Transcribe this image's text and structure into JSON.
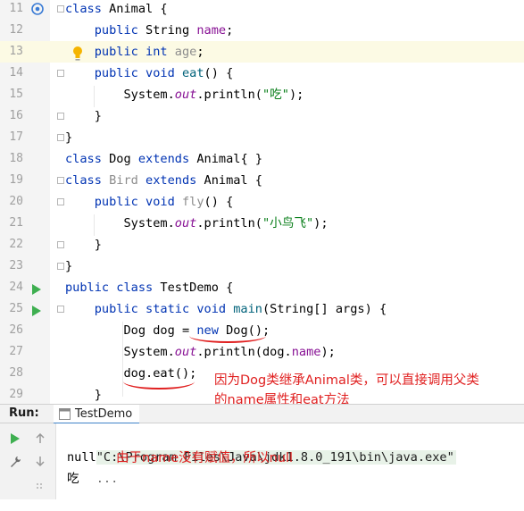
{
  "editor": {
    "lines": [
      {
        "num": "11",
        "tokens": [
          {
            "t": "class ",
            "c": "kw"
          },
          {
            "t": "Animal {",
            "c": ""
          }
        ]
      },
      {
        "num": "12",
        "tokens": [
          {
            "t": "    public ",
            "c": "kw"
          },
          {
            "t": "String ",
            "c": ""
          },
          {
            "t": "name",
            "c": "fd"
          },
          {
            "t": ";",
            "c": ""
          }
        ]
      },
      {
        "num": "13",
        "tokens": [
          {
            "t": "    public ",
            "c": "kw"
          },
          {
            "t": "int ",
            "c": "kw"
          },
          {
            "t": "age",
            "c": "gray"
          },
          {
            "t": ";",
            "c": ""
          }
        ]
      },
      {
        "num": "14",
        "tokens": [
          {
            "t": "    public ",
            "c": "kw"
          },
          {
            "t": "void ",
            "c": "kw"
          },
          {
            "t": "eat",
            "c": "fn"
          },
          {
            "t": "() {",
            "c": ""
          }
        ]
      },
      {
        "num": "15",
        "tokens": [
          {
            "t": "        System.",
            "c": ""
          },
          {
            "t": "out",
            "c": "ital"
          },
          {
            "t": ".println(",
            "c": ""
          },
          {
            "t": "\"吃\"",
            "c": "st"
          },
          {
            "t": ");",
            "c": ""
          }
        ]
      },
      {
        "num": "16",
        "tokens": [
          {
            "t": "    }",
            "c": ""
          }
        ]
      },
      {
        "num": "17",
        "tokens": [
          {
            "t": "}",
            "c": ""
          }
        ]
      },
      {
        "num": "18",
        "tokens": [
          {
            "t": "class ",
            "c": "kw"
          },
          {
            "t": "Dog ",
            "c": ""
          },
          {
            "t": "extends ",
            "c": "kw"
          },
          {
            "t": "Animal{ }",
            "c": ""
          }
        ]
      },
      {
        "num": "19",
        "tokens": [
          {
            "t": "class ",
            "c": "kw"
          },
          {
            "t": "Bird ",
            "c": "gray"
          },
          {
            "t": "extends ",
            "c": "kw"
          },
          {
            "t": "Animal {",
            "c": ""
          }
        ]
      },
      {
        "num": "20",
        "tokens": [
          {
            "t": "    public ",
            "c": "kw"
          },
          {
            "t": "void ",
            "c": "kw"
          },
          {
            "t": "fly",
            "c": "gray"
          },
          {
            "t": "() {",
            "c": ""
          }
        ]
      },
      {
        "num": "21",
        "tokens": [
          {
            "t": "        System.",
            "c": ""
          },
          {
            "t": "out",
            "c": "ital"
          },
          {
            "t": ".println(",
            "c": ""
          },
          {
            "t": "\"小鸟飞\"",
            "c": "st"
          },
          {
            "t": ");",
            "c": ""
          }
        ]
      },
      {
        "num": "22",
        "tokens": [
          {
            "t": "    }",
            "c": ""
          }
        ]
      },
      {
        "num": "23",
        "tokens": [
          {
            "t": "}",
            "c": ""
          }
        ]
      },
      {
        "num": "24",
        "tokens": [
          {
            "t": "public ",
            "c": "kw"
          },
          {
            "t": "class ",
            "c": "kw"
          },
          {
            "t": "TestDemo {",
            "c": ""
          }
        ]
      },
      {
        "num": "25",
        "tokens": [
          {
            "t": "    public ",
            "c": "kw"
          },
          {
            "t": "static ",
            "c": "kw"
          },
          {
            "t": "void ",
            "c": "kw"
          },
          {
            "t": "main",
            "c": "fn"
          },
          {
            "t": "(String[] args) {",
            "c": ""
          }
        ]
      },
      {
        "num": "26",
        "tokens": [
          {
            "t": "        Dog dog = ",
            "c": ""
          },
          {
            "t": "new ",
            "c": "kw"
          },
          {
            "t": "Dog();",
            "c": ""
          }
        ]
      },
      {
        "num": "27",
        "tokens": [
          {
            "t": "        System.",
            "c": ""
          },
          {
            "t": "out",
            "c": "ital"
          },
          {
            "t": ".println(dog.",
            "c": ""
          },
          {
            "t": "name",
            "c": "fd"
          },
          {
            "t": ");",
            "c": ""
          }
        ]
      },
      {
        "num": "28",
        "tokens": [
          {
            "t": "        dog.eat();",
            "c": ""
          }
        ]
      },
      {
        "num": "29",
        "tokens": [
          {
            "t": "    }",
            "c": ""
          }
        ]
      }
    ]
  },
  "annotations": {
    "inherit_line1": "因为Dog类继承Animal类，可以直接调用父类",
    "inherit_line2": "的name属性和eat方法",
    "null_note": "由于name没有赋值，所以null"
  },
  "run_panel": {
    "label": "Run:",
    "tab_name": "TestDemo",
    "command": "\"C:\\Program Files\\Java\\jdk1.8.0_191\\bin\\java.exe\"",
    "ellipsis": "...",
    "output_lines": [
      "null",
      "吃"
    ]
  },
  "colors": {
    "keyword": "#0033b3",
    "field": "#871094",
    "string": "#067d17",
    "annotation_red": "#e02020",
    "run_green": "#3eaf50"
  }
}
